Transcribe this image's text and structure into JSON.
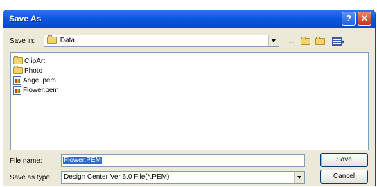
{
  "window": {
    "title": "Save As",
    "help_label": "?",
    "close_label": "✕"
  },
  "save_in": {
    "label": "Save in:",
    "value": "Data"
  },
  "toolbar": {
    "back_icon": "back-arrow-icon",
    "up_icon": "up-folder-icon",
    "new_folder_icon": "new-folder-icon",
    "views_icon": "views-menu-icon"
  },
  "files": [
    {
      "name": "ClipArt",
      "type": "folder"
    },
    {
      "name": "Photo",
      "type": "folder"
    },
    {
      "name": "Angel.pem",
      "type": "file"
    },
    {
      "name": "Flower.pem",
      "type": "file"
    }
  ],
  "file_name": {
    "label": "File name:",
    "value": "Flower.PEM"
  },
  "save_as_type": {
    "label": "Save as type:",
    "value": "Design Center Ver 6.0 File(*.PEM)"
  },
  "buttons": {
    "save": "Save",
    "cancel": "Cancel"
  },
  "colors": {
    "titlebar": "#0b58e0",
    "dialog_bg": "#ece9d8",
    "selection": "#316ac5"
  }
}
